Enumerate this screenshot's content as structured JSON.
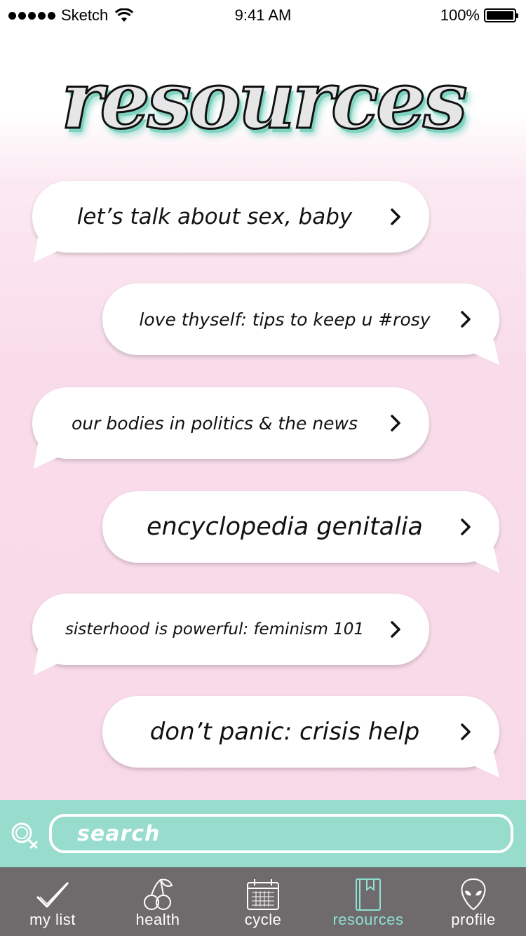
{
  "status_bar": {
    "carrier": "Sketch",
    "time": "9:41 AM",
    "battery": "100%"
  },
  "title": "resources",
  "items": [
    {
      "label": "let’s talk about sex, baby"
    },
    {
      "label": "love thyself: tips to keep u #rosy"
    },
    {
      "label": "our bodies in politics & the news"
    },
    {
      "label": "encyclopedia genitalia"
    },
    {
      "label": "sisterhood is powerful: feminism 101"
    },
    {
      "label": "don’t panic: crisis help"
    }
  ],
  "search": {
    "placeholder": "search"
  },
  "tabs": [
    {
      "label": "my list",
      "icon": "checkmark-icon",
      "active": false
    },
    {
      "label": "health",
      "icon": "cherries-icon",
      "active": false
    },
    {
      "label": "cycle",
      "icon": "calendar-icon",
      "active": false
    },
    {
      "label": "resources",
      "icon": "book-icon",
      "active": true
    },
    {
      "label": "profile",
      "icon": "alien-icon",
      "active": false
    }
  ],
  "colors": {
    "accent": "#97dccd",
    "tab_bar": "#6f6b6d",
    "active_tab": "#8fe0cf",
    "background_pink": "#f8d9e8"
  }
}
